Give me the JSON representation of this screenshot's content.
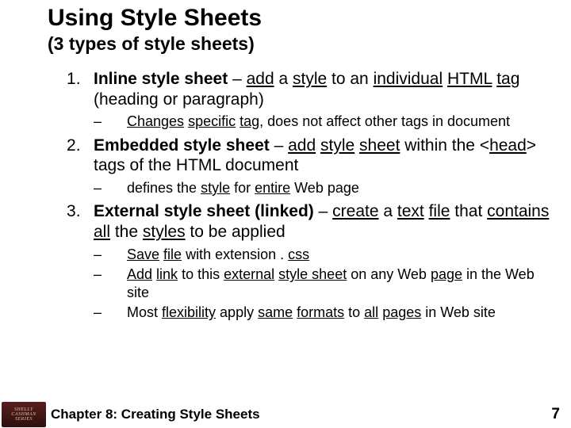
{
  "title": "Using Style Sheets",
  "subtitle": "(3 types of style sheets)",
  "items": [
    {
      "lead_b": "Inline style sheet",
      "html": " – <span class=\"ul-w\">add</span> a <span class=\"ul-w\">style</span> to an <span class=\"ul-w\">individual</span> <span class=\"ul-w\">HTML</span> <span class=\"ul-w\">tag</span> (heading or paragraph)",
      "subs": [
        "<span class=\"ul-w\">Changes</span> <span class=\"ul-w\">specific</span> <span class=\"ul-w\">tag</span>, does not affect other tags in document"
      ]
    },
    {
      "lead_b": "Embedded style sheet",
      "html": " – <span class=\"ul-w\">add</span> <span class=\"ul-w\">style</span> <span class=\"ul-w\">sheet</span> within the &lt;<span class=\"ul-w\">head</span>&gt; tags of the HTML document",
      "subs": [
        "defines the <span class=\"ul-w\">style</span> for <span class=\"ul-w\">entire</span> Web page"
      ]
    },
    {
      "lead_b": "External style sheet (linked)",
      "html": " – <span class=\"ul-w\">create</span> a <span class=\"ul-w\">text</span> <span class=\"ul-w\">file</span> that <span class=\"ul-w\">contains</span> <span class=\"ul-w\">all</span> the <span class=\"ul-w\">styles</span> to be applied",
      "subs": [
        "<span class=\"ul-w\">Save</span> <span class=\"ul-w\">file</span> with extension . <span class=\"ul-w\">css</span>",
        "<span class=\"ul-w\">Add</span> <span class=\"ul-w\">link</span> to this <span class=\"ul-w\">external</span> <span class=\"ul-w\">style sheet</span> on any Web <span class=\"ul-w\">page</span> in the Web site",
        "Most <span class=\"ul-w\">flexibility</span> apply <span class=\"ul-w\">same</span> <span class=\"ul-w\">formats</span> to <span class=\"ul-w\">all</span> <span class=\"ul-w\">pages</span> in Web site"
      ]
    }
  ],
  "footer": {
    "logo": {
      "line1": "SHELLY",
      "line2": "CASHMAN",
      "line3": "SERIES"
    },
    "chapter": "Chapter 8: Creating Style Sheets",
    "page": "7"
  }
}
